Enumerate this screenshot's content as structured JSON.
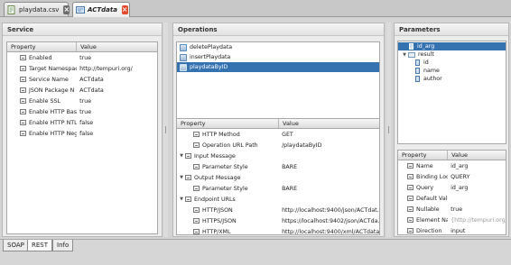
{
  "tabs": [
    {
      "label": "playdata.csv",
      "icon": "csv-file-icon",
      "active": false
    },
    {
      "label": "ACTdata",
      "icon": "service-file-icon",
      "active": true
    }
  ],
  "service": {
    "title": "Service",
    "columns": [
      "Property",
      "Value"
    ],
    "rows": [
      {
        "name": "Enabled",
        "value": "true"
      },
      {
        "name": "Target Namespac",
        "value": "http://tempuri.org/"
      },
      {
        "name": "Service Name",
        "value": "ACTdata"
      },
      {
        "name": "JSON Package N",
        "value": "ACTdata"
      },
      {
        "name": "Enable SSL",
        "value": "true"
      },
      {
        "name": "Enable HTTP Bas",
        "value": "true"
      },
      {
        "name": "Enable HTTP NTL",
        "value": "false"
      },
      {
        "name": "Enable HTTP Neg",
        "value": "false"
      }
    ]
  },
  "operations": {
    "title": "Operations",
    "items": [
      "deletePlaydata",
      "insertPlaydata",
      "playdataByID"
    ],
    "selected_index": 2,
    "columns": [
      "Property",
      "Value"
    ],
    "rows": [
      {
        "name": "HTTP Method",
        "value": "GET",
        "level": 1,
        "group": false
      },
      {
        "name": "Operation URL Path",
        "value": "/playdataByID",
        "level": 1,
        "group": false
      },
      {
        "name": "Input Message",
        "value": "",
        "level": 0,
        "group": true
      },
      {
        "name": "Parameter Style",
        "value": "BARE",
        "level": 1,
        "group": false
      },
      {
        "name": "Output Message",
        "value": "",
        "level": 0,
        "group": true
      },
      {
        "name": "Parameter Style",
        "value": "BARE",
        "level": 1,
        "group": false
      },
      {
        "name": "Endpoint URLs",
        "value": "",
        "level": 0,
        "group": true
      },
      {
        "name": "HTTP/JSON",
        "value": "http://localhost:9400/json/ACTdat...",
        "level": 1,
        "group": false
      },
      {
        "name": "HTTPS/JSON",
        "value": "https://localhost:9402/json/ACTda...",
        "level": 1,
        "group": false
      },
      {
        "name": "HTTP/XML",
        "value": "http://localhost:9400/xml/ACTdata...",
        "level": 1,
        "group": false
      }
    ]
  },
  "parameters": {
    "title": "Parameters",
    "tree": [
      {
        "label": "id_arg",
        "level": 0,
        "selected": true,
        "kind": "field"
      },
      {
        "label": "result",
        "level": 0,
        "selected": false,
        "kind": "folder",
        "expanded": true
      },
      {
        "label": "id",
        "level": 1,
        "selected": false,
        "kind": "field"
      },
      {
        "label": "name",
        "level": 1,
        "selected": false,
        "kind": "field"
      },
      {
        "label": "author",
        "level": 1,
        "selected": false,
        "kind": "field"
      }
    ],
    "columns": [
      "Property",
      "Value"
    ],
    "rows": [
      {
        "name": "Name",
        "value": "id_arg",
        "grey": false
      },
      {
        "name": "Binding Loc",
        "value": "QUERY",
        "grey": false
      },
      {
        "name": "Query",
        "value": "id_arg",
        "grey": false
      },
      {
        "name": "Default Valu",
        "value": "",
        "grey": false
      },
      {
        "name": "Nullable",
        "value": "true",
        "grey": false
      },
      {
        "name": "Element Na",
        "value": "{http://tempuri.org/",
        "grey": true
      },
      {
        "name": "Direction",
        "value": "input",
        "grey": false
      }
    ]
  },
  "bottom_tabs": [
    {
      "label": "SOAP",
      "active": false
    },
    {
      "label": "REST",
      "active": true
    },
    {
      "label": "Info",
      "active": false
    }
  ],
  "colors": {
    "selection": "#3572b0",
    "close_active": "#e24a2a"
  }
}
